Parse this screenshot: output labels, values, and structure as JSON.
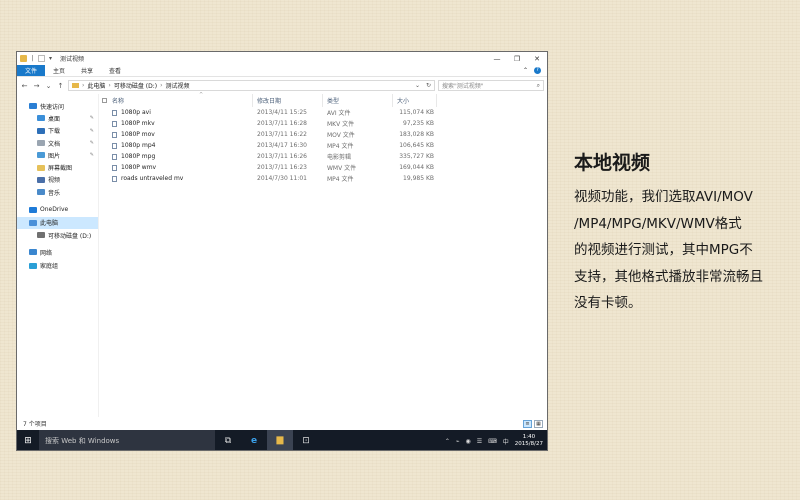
{
  "window": {
    "title": "测试视频",
    "minimize_glyph": "—",
    "maximize_glyph": "❐",
    "close_glyph": "✕"
  },
  "ribbon": {
    "tabs": [
      "文件",
      "主页",
      "共享",
      "查看"
    ],
    "expand_glyph": "⌃",
    "help_glyph": "?"
  },
  "address": {
    "back": "←",
    "forward": "→",
    "up_history": "⌄",
    "up": "↑",
    "crumbs": [
      "此电脑",
      "可移动磁盘 (D:)",
      "测试视频"
    ],
    "crumb_sep": "›",
    "dropdown": "⌄",
    "refresh": "↻",
    "search_placeholder": "搜索\"测试视频\"",
    "search_icon": "⌕"
  },
  "nav": {
    "items": [
      {
        "label": "快速访问",
        "icon": "star-icon",
        "color": "#2a7fd4"
      },
      {
        "label": "桌面",
        "icon": "desktop-icon",
        "color": "#3b8fd9",
        "pinned": true
      },
      {
        "label": "下载",
        "icon": "download-icon",
        "color": "#2d6fb8",
        "pinned": true
      },
      {
        "label": "文档",
        "icon": "document-icon",
        "color": "#9aa5b1",
        "pinned": true
      },
      {
        "label": "图片",
        "icon": "picture-icon",
        "color": "#4a9ad6",
        "pinned": true
      },
      {
        "label": "屏幕截图",
        "icon": "folder-icon",
        "color": "#e6c15a"
      },
      {
        "label": "视频",
        "icon": "video-icon",
        "color": "#4a6fa8"
      },
      {
        "label": "音乐",
        "icon": "music-icon",
        "color": "#4a8ac9"
      },
      {
        "label": "OneDrive",
        "icon": "cloud-icon",
        "color": "#1e7bd8"
      },
      {
        "label": "此电脑",
        "icon": "computer-icon",
        "color": "#4a90d9",
        "selected": true
      },
      {
        "label": "可移动磁盘 (D:)",
        "icon": "usb-drive-icon",
        "color": "#707070"
      },
      {
        "label": "网络",
        "icon": "network-icon",
        "color": "#3a86cf"
      },
      {
        "label": "家庭组",
        "icon": "homegroup-icon",
        "color": "#2a9fd6"
      }
    ],
    "pin_glyph": "✎"
  },
  "table": {
    "columns": [
      "名称",
      "修改日期",
      "类型",
      "大小"
    ],
    "sort_glyph": "^",
    "rows": [
      {
        "name": "1080p avi",
        "date": "2013/4/11 15:25",
        "type": "AVI 文件",
        "size": "115,074 KB"
      },
      {
        "name": "1080P mkv",
        "date": "2013/7/11 16:28",
        "type": "MKV 文件",
        "size": "97,235 KB"
      },
      {
        "name": "1080P mov",
        "date": "2013/7/11 16:22",
        "type": "MOV 文件",
        "size": "183,028 KB"
      },
      {
        "name": "1080p mp4",
        "date": "2013/4/17 16:30",
        "type": "MP4 文件",
        "size": "106,645 KB"
      },
      {
        "name": "1080P mpg",
        "date": "2013/7/11 16:26",
        "type": "电影剪辑",
        "size": "335,727 KB"
      },
      {
        "name": "1080P wmv",
        "date": "2013/7/11 16:23",
        "type": "WMV 文件",
        "size": "169,044 KB"
      },
      {
        "name": "roads untraveled mv",
        "date": "2014/7/30 11:01",
        "type": "MP4 文件",
        "size": "19,985 KB"
      }
    ]
  },
  "status": {
    "count": "7 个项目",
    "details_glyph": "≡",
    "tiles_glyph": "▦"
  },
  "taskbar": {
    "start_glyph": "⊞",
    "search_placeholder": "搜索 Web 和 Windows",
    "task_view_glyph": "⧉",
    "edge_glyph": "e",
    "explorer_glyph": "▆",
    "store_glyph": "⊡",
    "tray": [
      "⌃",
      "⌁",
      "◉",
      "☰",
      "⌨",
      "中"
    ],
    "time": "1:40",
    "date": "2015/8/27"
  },
  "side_text": {
    "title": "本地视频",
    "lines": [
      "视频功能，我们选取AVI/MOV",
      "/MP4/MPG/MKV/WMV格式",
      "的视频进行测试，其中MPG不",
      "支持，其他格式播放非常流畅且",
      "没有卡顿。"
    ]
  }
}
